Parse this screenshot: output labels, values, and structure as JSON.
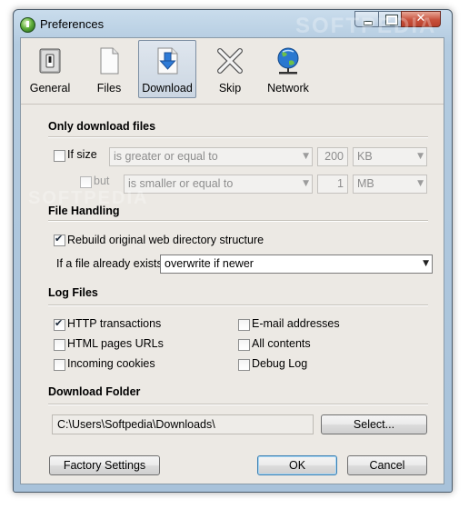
{
  "window": {
    "title": "Preferences"
  },
  "toolbar": {
    "items": [
      {
        "label": "General",
        "icon": "switch-icon"
      },
      {
        "label": "Files",
        "icon": "file-icon"
      },
      {
        "label": "Download",
        "icon": "download-icon",
        "active": true
      },
      {
        "label": "Skip",
        "icon": "skip-x-icon"
      },
      {
        "label": "Network",
        "icon": "globe-network-icon"
      }
    ]
  },
  "only_download": {
    "title": "Only download files",
    "if_size": {
      "label": "If size",
      "checked": false
    },
    "condition1": {
      "value": "is greater or equal to"
    },
    "size1": {
      "value": "200"
    },
    "unit1": {
      "value": "KB"
    },
    "but": {
      "label": "but",
      "checked": false,
      "disabled": true
    },
    "condition2": {
      "value": "is smaller or equal to"
    },
    "size2": {
      "value": "1"
    },
    "unit2": {
      "value": "MB"
    }
  },
  "file_handling": {
    "title": "File Handling",
    "rebuild": {
      "label": "Rebuild original web directory structure",
      "checked": true
    },
    "exists_label": "If a file already exists",
    "exists_value": "overwrite if newer"
  },
  "log_files": {
    "title": "Log Files",
    "left": [
      {
        "label": "HTTP transactions",
        "checked": true
      },
      {
        "label": "HTML pages URLs",
        "checked": false
      },
      {
        "label": "Incoming cookies",
        "checked": false
      }
    ],
    "right": [
      {
        "label": "E-mail addresses",
        "checked": false
      },
      {
        "label": "All contents",
        "checked": false
      },
      {
        "label": "Debug Log",
        "checked": false
      }
    ]
  },
  "download_folder": {
    "title": "Download Folder",
    "path": "C:\\Users\\Softpedia\\Downloads\\",
    "select_label": "Select..."
  },
  "buttons": {
    "factory_label": "Factory Settings",
    "ok_label": "OK",
    "cancel_label": "Cancel"
  },
  "watermark": "SOFTPEDIA",
  "colors": {
    "accent": "#3c7fb1",
    "dialog_bg": "#ece9e4",
    "title_bar": "#b3cbe0",
    "close_button": "#c8513c"
  }
}
